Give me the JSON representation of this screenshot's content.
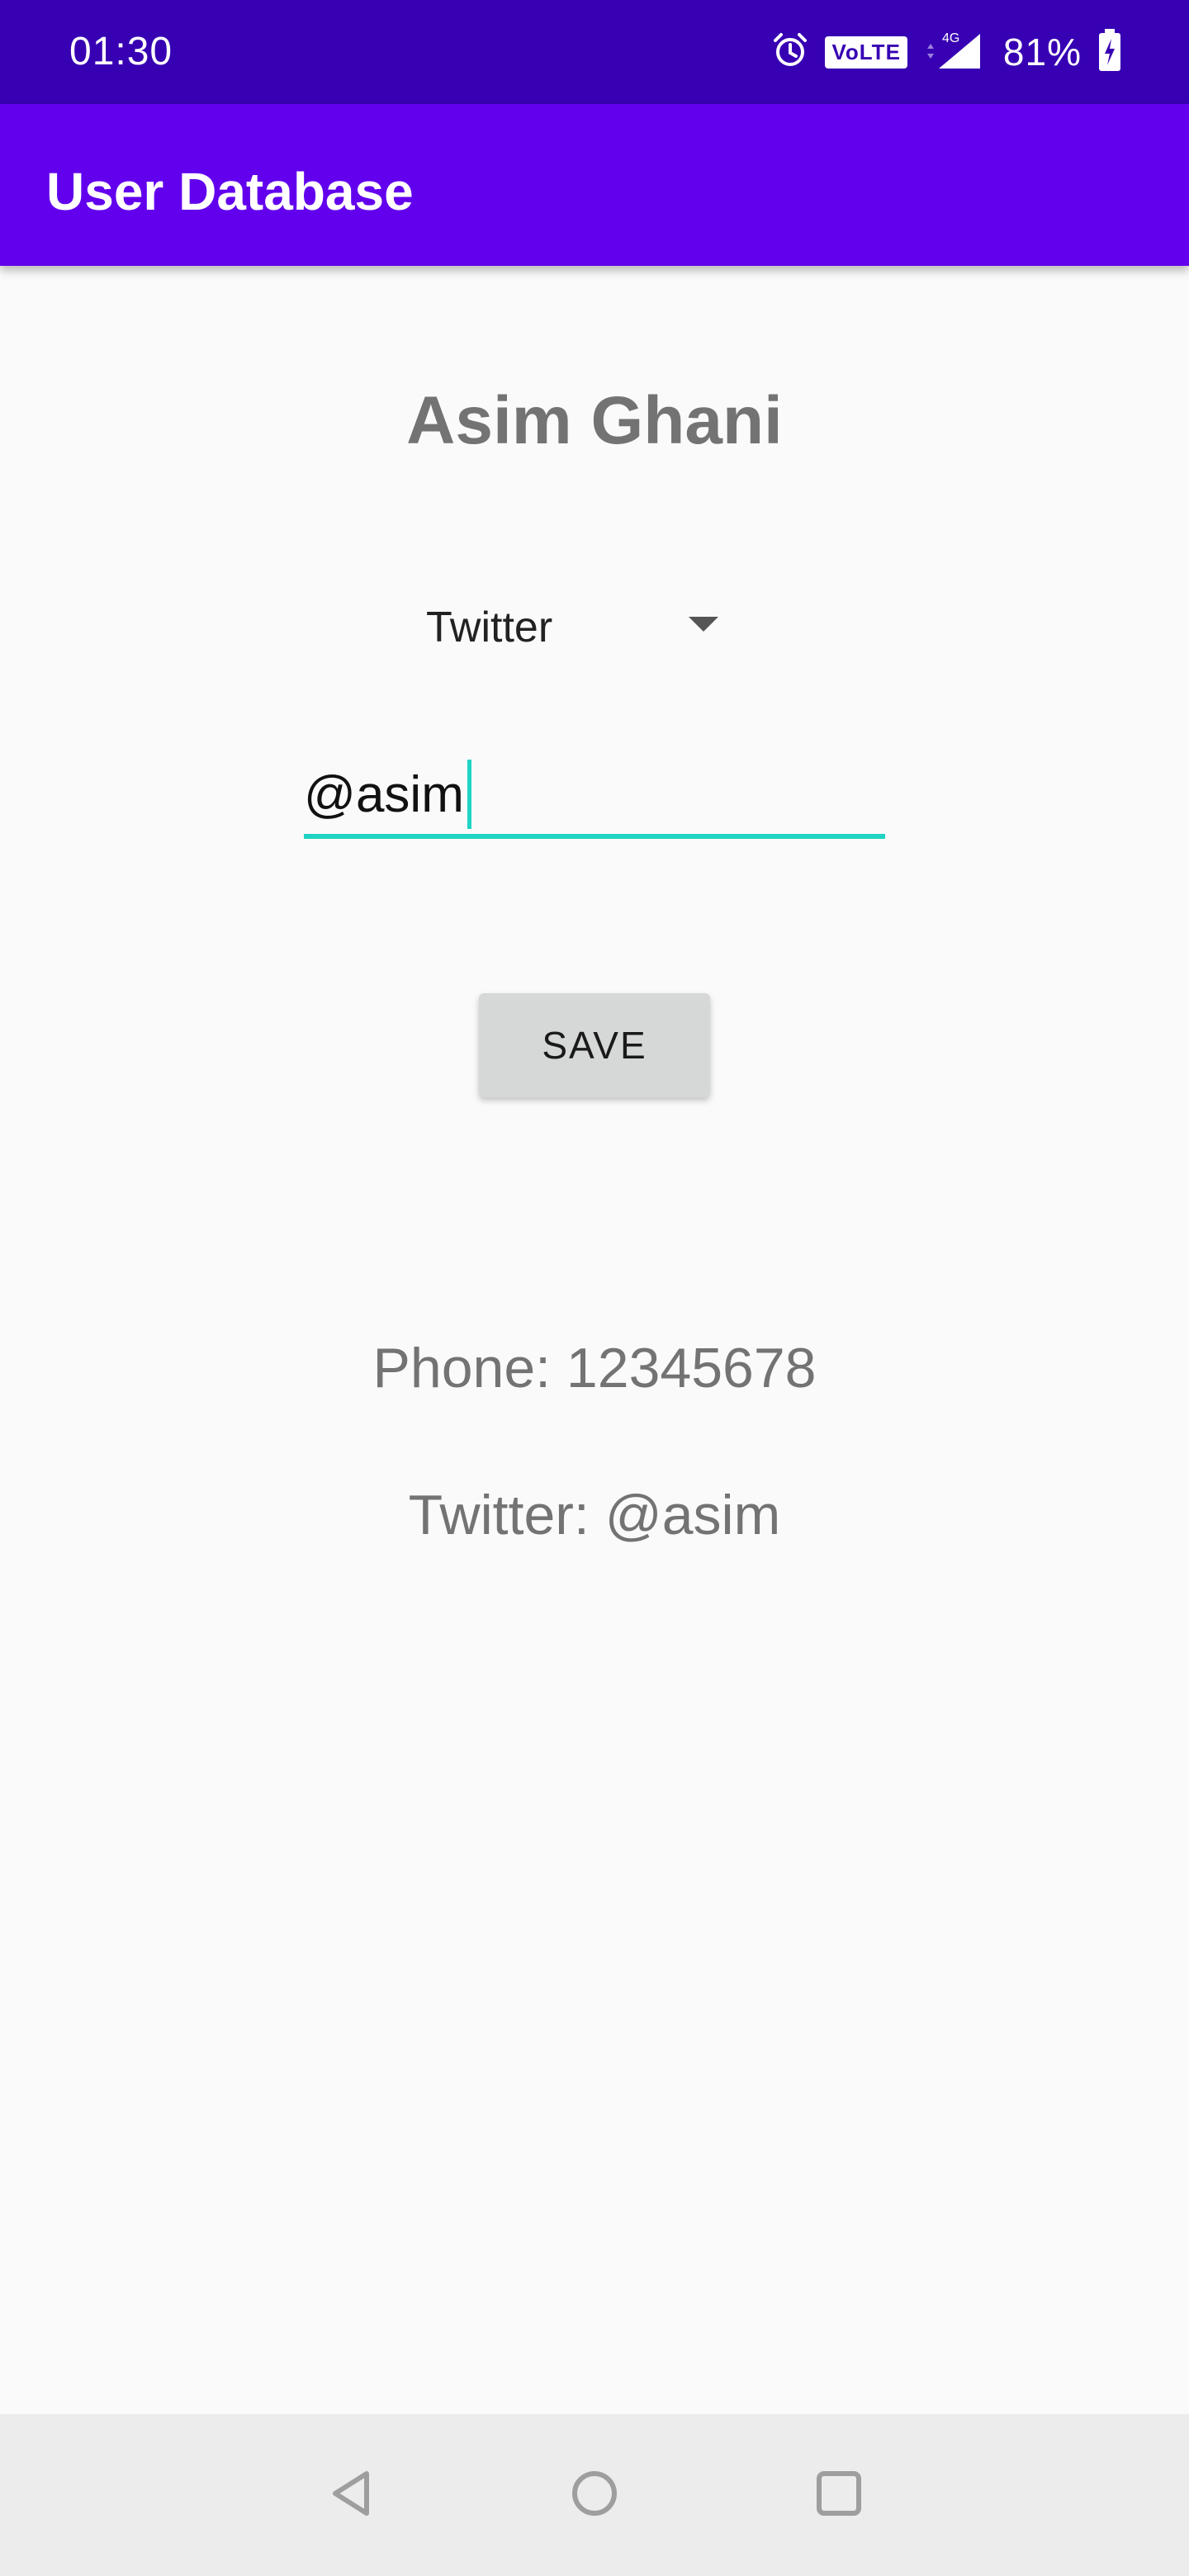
{
  "status_bar": {
    "time": "01:30",
    "volte_label": "VoLTE",
    "network_label": "4G",
    "battery_percent": "81%"
  },
  "app_bar": {
    "title": "User Database"
  },
  "main": {
    "user_name": "Asim Ghani",
    "dropdown": {
      "selected": "Twitter"
    },
    "input": {
      "value": "@asim"
    },
    "save_label": "SAVE",
    "info": {
      "phone": "Phone:  12345678",
      "twitter": "Twitter:  @asim"
    }
  },
  "nav_bar": {
    "icons": [
      "back-icon",
      "home-icon",
      "recents-icon"
    ]
  },
  "colors": {
    "status_bar": "#3700b3",
    "app_bar": "#6200ee",
    "accent": "#1fd4c4",
    "background": "#fafafa",
    "button": "#d6d7d7"
  }
}
